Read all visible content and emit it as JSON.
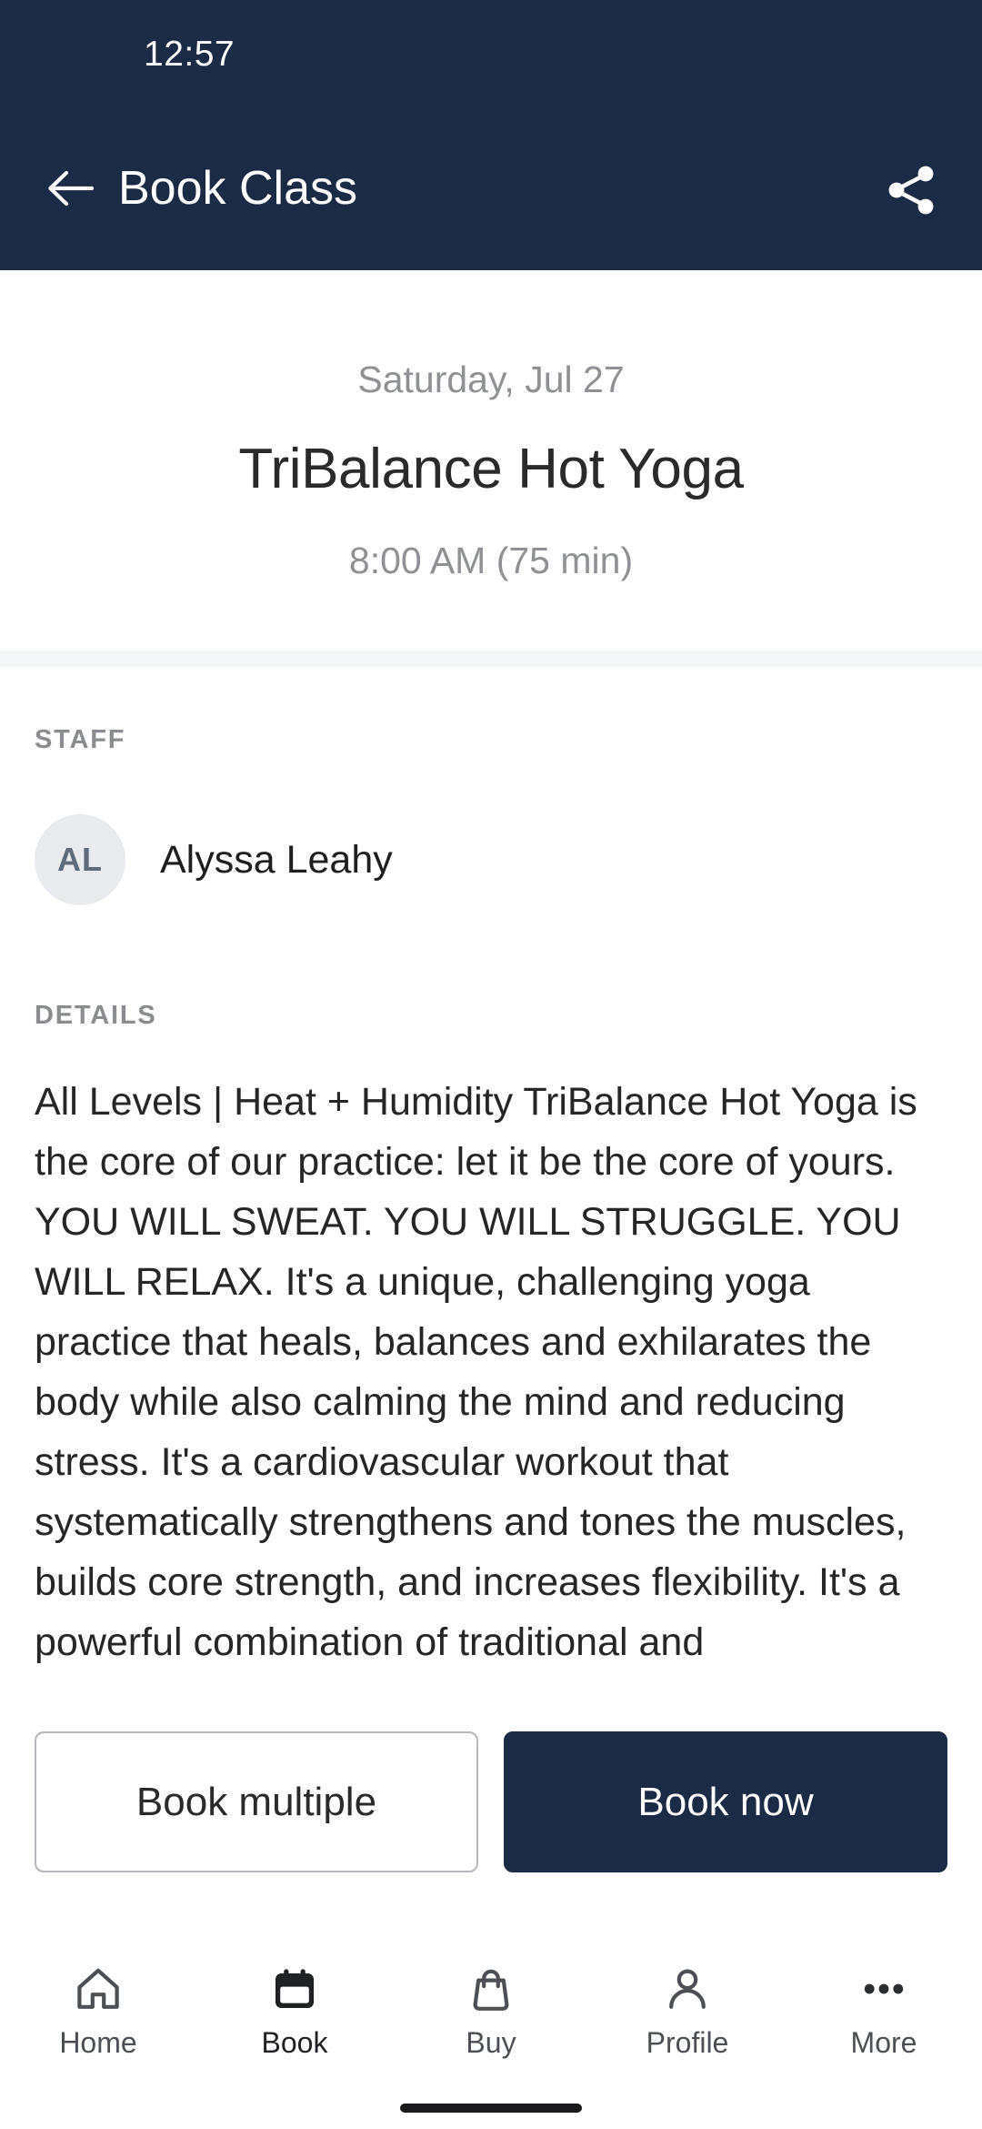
{
  "status_bar": {
    "time": "12:57"
  },
  "header": {
    "title": "Book Class",
    "back_icon": "arrow-left-icon",
    "share_icon": "share-icon",
    "background_color": "#1C2B45"
  },
  "class_summary": {
    "date": "Saturday, Jul 27",
    "name": "TriBalance Hot Yoga",
    "time": "8:00 AM (75 min)"
  },
  "staff_section": {
    "label": "STAFF",
    "avatar_initials": "AL",
    "name": "Alyssa Leahy"
  },
  "details_section": {
    "label": "DETAILS",
    "body": "All Levels | Heat + Humidity TriBalance Hot Yoga is the core of our practice: let it be the core of yours. YOU WILL SWEAT. YOU WILL STRUGGLE. YOU WILL RELAX. It's a unique, challenging yoga practice that heals, balances and exhilarates the body while also calming the mind and reducing stress. It's a cardiovascular workout that systematically strengthens and tones the muscles, builds core strength, and increases flexibility. It's a powerful combination of traditional and"
  },
  "actions": {
    "secondary_label": "Book multiple",
    "primary_label": "Book now",
    "primary_color": "#1C2B45"
  },
  "bottom_nav": {
    "items": [
      {
        "label": "Home",
        "icon": "home-icon",
        "active": false
      },
      {
        "label": "Book",
        "icon": "calendar-icon",
        "active": true
      },
      {
        "label": "Buy",
        "icon": "bag-icon",
        "active": false
      },
      {
        "label": "Profile",
        "icon": "person-icon",
        "active": false
      },
      {
        "label": "More",
        "icon": "ellipsis-icon",
        "active": false
      }
    ]
  }
}
